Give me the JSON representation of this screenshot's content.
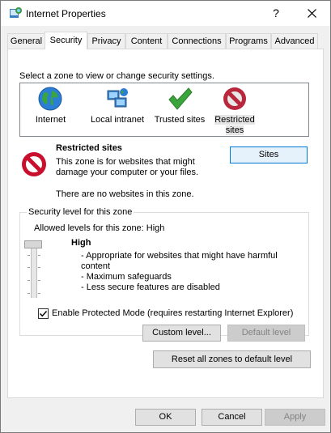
{
  "window": {
    "title": "Internet Properties",
    "help_label": "?",
    "close_icon": "close-icon"
  },
  "tabs": [
    {
      "label": "General"
    },
    {
      "label": "Security"
    },
    {
      "label": "Privacy"
    },
    {
      "label": "Content"
    },
    {
      "label": "Connections"
    },
    {
      "label": "Programs"
    },
    {
      "label": "Advanced"
    }
  ],
  "active_tab": "Security",
  "security": {
    "zone_prompt": "Select a zone to view or change security settings.",
    "zones": [
      {
        "label": "Internet",
        "icon": "globe-icon"
      },
      {
        "label": "Local intranet",
        "icon": "network-icon"
      },
      {
        "label": "Trusted sites",
        "icon": "checkmark-icon"
      },
      {
        "label_line1": "Restricted",
        "label_line2": "sites",
        "icon": "restricted-icon",
        "selected": true
      }
    ],
    "selected_zone": {
      "title": "Restricted sites",
      "description_line1": "This zone is for websites that might",
      "description_line2": "damage your computer or your files.",
      "status": "There are no websites in this zone.",
      "sites_button": "Sites"
    },
    "level_group": {
      "title": "Security level for this zone",
      "allowed": "Allowed levels for this zone: High",
      "level_name": "High",
      "bullets": [
        "- Appropriate for websites that might have harmful",
        "content",
        "- Maximum safeguards",
        "- Less secure features are disabled"
      ],
      "protected_mode_label": "Enable Protected Mode (requires restarting Internet Explorer)",
      "protected_mode_checked": true,
      "custom_level_button": "Custom level...",
      "default_level_button": "Default level"
    },
    "reset_all_button": "Reset all zones to default level"
  },
  "footer": {
    "ok": "OK",
    "cancel": "Cancel",
    "apply": "Apply"
  },
  "colors": {
    "accent": "#0078d7",
    "restricted_red": "#c8102e",
    "trusted_green": "#3aa53a"
  }
}
